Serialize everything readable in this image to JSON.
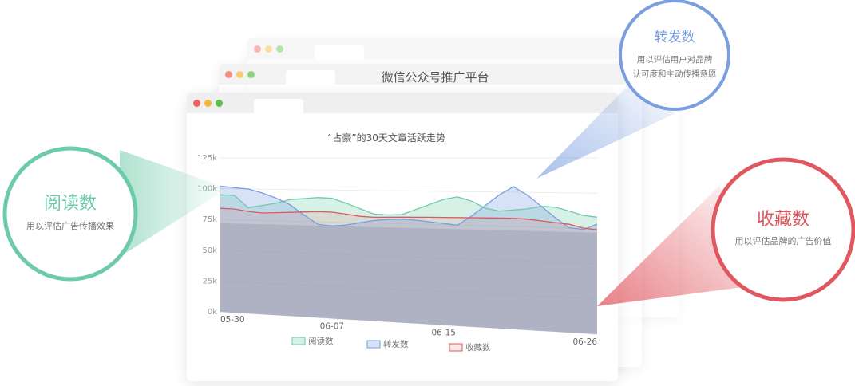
{
  "app_title": "微信公众号推广平台",
  "colors": {
    "read": "#6ecba9",
    "forward": "#7b9ee0",
    "favorite": "#e0575f",
    "window_bar": "#efefef",
    "dot_red": "#f0625a",
    "dot_yellow": "#f5b73b",
    "dot_green": "#5cc24a"
  },
  "bubbles": {
    "read": {
      "title": "阅读数",
      "desc": "用以评估广告传播效果",
      "icon": "circle-callout"
    },
    "forward": {
      "title": "转发数",
      "desc_line1": "用以评估用户对品牌",
      "desc_line2": "认可度和主动传播意愿",
      "icon": "circle-callout"
    },
    "favorite": {
      "title": "收藏数",
      "desc": "用以评估品牌的广告价值",
      "icon": "circle-callout"
    }
  },
  "chart_data": {
    "type": "area",
    "title": "“占豪”的30天文章活跃走势",
    "y_ticks": [
      "0k",
      "25k",
      "50k",
      "75k",
      "100k",
      "125k"
    ],
    "ylim": [
      0,
      125000
    ],
    "x_labels": [
      "05-30",
      "06-07",
      "06-15",
      "06-26"
    ],
    "x_label_index": [
      0,
      8,
      16,
      27
    ],
    "grid": true,
    "legend_position": "bottom",
    "series": [
      {
        "name": "阅读数",
        "key": "read",
        "values": [
          95000,
          94800,
          85000,
          87000,
          89000,
          92000,
          93000,
          94000,
          93500,
          90000,
          86000,
          82000,
          81500,
          82000,
          86000,
          90000,
          94000,
          96000,
          93000,
          88000,
          86000,
          87000,
          88000,
          90000,
          89500,
          87000,
          84000,
          83000
        ]
      },
      {
        "name": "转发数",
        "key": "forward",
        "values": [
          102000,
          101000,
          100000,
          97000,
          93000,
          88000,
          80000,
          73000,
          72000,
          73000,
          75000,
          77000,
          78000,
          78500,
          78000,
          77000,
          76000,
          75000,
          82000,
          90000,
          98000,
          104000,
          98000,
          90000,
          82000,
          75000,
          74000,
          78000
        ]
      },
      {
        "name": "收藏数",
        "key": "favorite",
        "values": [
          84000,
          83800,
          82000,
          81000,
          81500,
          82000,
          82500,
          83000,
          82800,
          81500,
          80000,
          79500,
          79800,
          80000,
          80200,
          80400,
          80500,
          80600,
          80700,
          80800,
          80900,
          81000,
          80500,
          79500,
          78500,
          77500,
          75000,
          74000
        ]
      }
    ]
  }
}
